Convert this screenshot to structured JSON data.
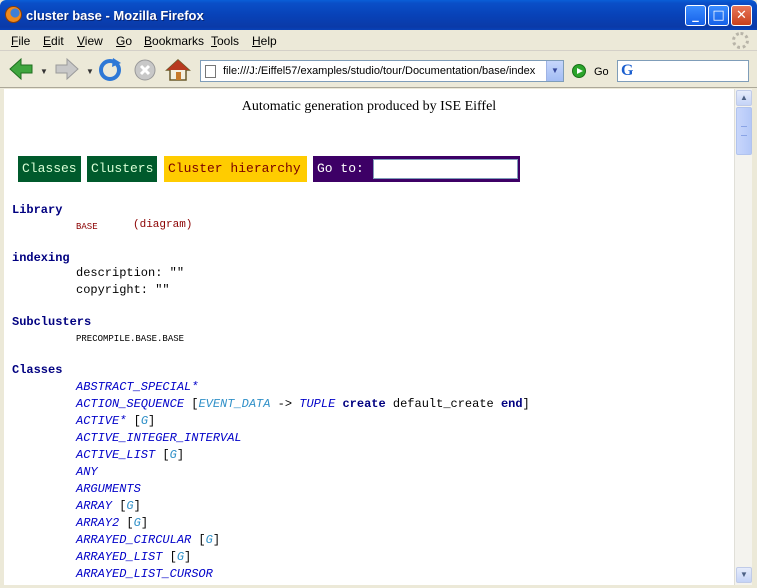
{
  "window": {
    "title": "cluster base - Mozilla Firefox"
  },
  "menu": [
    "File",
    "Edit",
    "View",
    "Go",
    "Bookmarks",
    "Tools",
    "Help"
  ],
  "toolbar": {
    "url": "file:///J:/Eiffel57/examples/studio/tour/Documentation/base/index",
    "go_label": "Go",
    "search_logo": "G"
  },
  "content": {
    "header": "Automatic generation produced by ISE Eiffel",
    "nav": {
      "classes": "Classes",
      "clusters": "Clusters",
      "hierarchy": "Cluster hierarchy",
      "goto": "Go to:"
    },
    "library_label": "Library",
    "library_name": "BASE",
    "library_diagram": "(diagram)",
    "indexing_label": "indexing",
    "description_line": "description: \"\"",
    "copyright_line": "copyright: \"\"",
    "subclusters_label": "Subclusters",
    "subcluster_name": "PRECOMPILE.BASE.BASE",
    "classes_label": "Classes",
    "classes": [
      "ABSTRACT_SPECIAL*",
      "ACTION_SEQUENCE",
      "ACTIVE*",
      "ACTIVE_INTEGER_INTERVAL",
      "ACTIVE_LIST",
      "ANY",
      "ARGUMENTS",
      "ARRAY",
      "ARRAY2",
      "ARRAYED_CIRCULAR",
      "ARRAYED_LIST",
      "ARRAYED_LIST_CURSOR"
    ],
    "generic_marker": "G",
    "action_sequence_generic": {
      "event_data": "EVENT_DATA",
      "arrow": "->",
      "tuple": "TUPLE",
      "create": "create",
      "default_create": "default_create",
      "end": "end"
    }
  }
}
